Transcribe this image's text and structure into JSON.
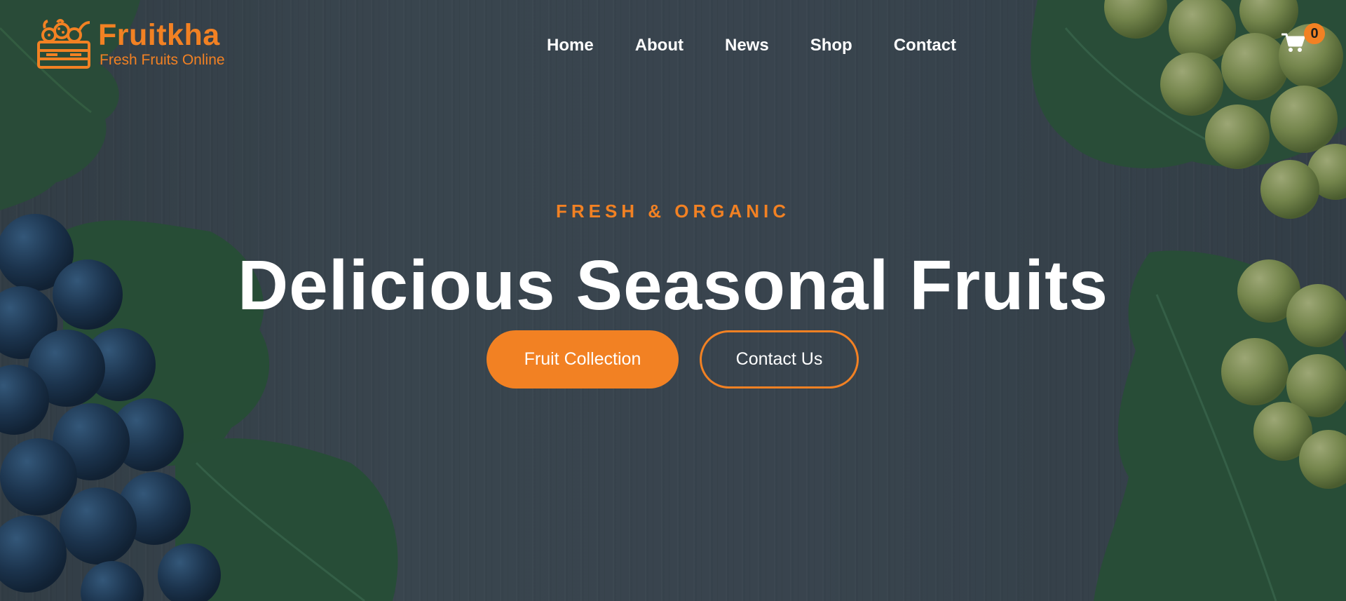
{
  "brand": {
    "name": "Fruitkha",
    "tagline": "Fresh Fruits Online",
    "logo_icon": "fruit-basket-icon"
  },
  "nav": {
    "items": [
      {
        "label": "Home"
      },
      {
        "label": "About"
      },
      {
        "label": "News"
      },
      {
        "label": "Shop"
      },
      {
        "label": "Contact"
      }
    ]
  },
  "cart": {
    "icon": "shopping-cart-icon",
    "count": "0"
  },
  "hero": {
    "eyebrow": "FRESH & ORGANIC",
    "headline": "Delicious Seasonal Fruits",
    "primary_button": "Fruit Collection",
    "secondary_button": "Contact Us"
  },
  "colors": {
    "accent": "#f28123",
    "text": "#ffffff",
    "background": "#3f4b52"
  }
}
